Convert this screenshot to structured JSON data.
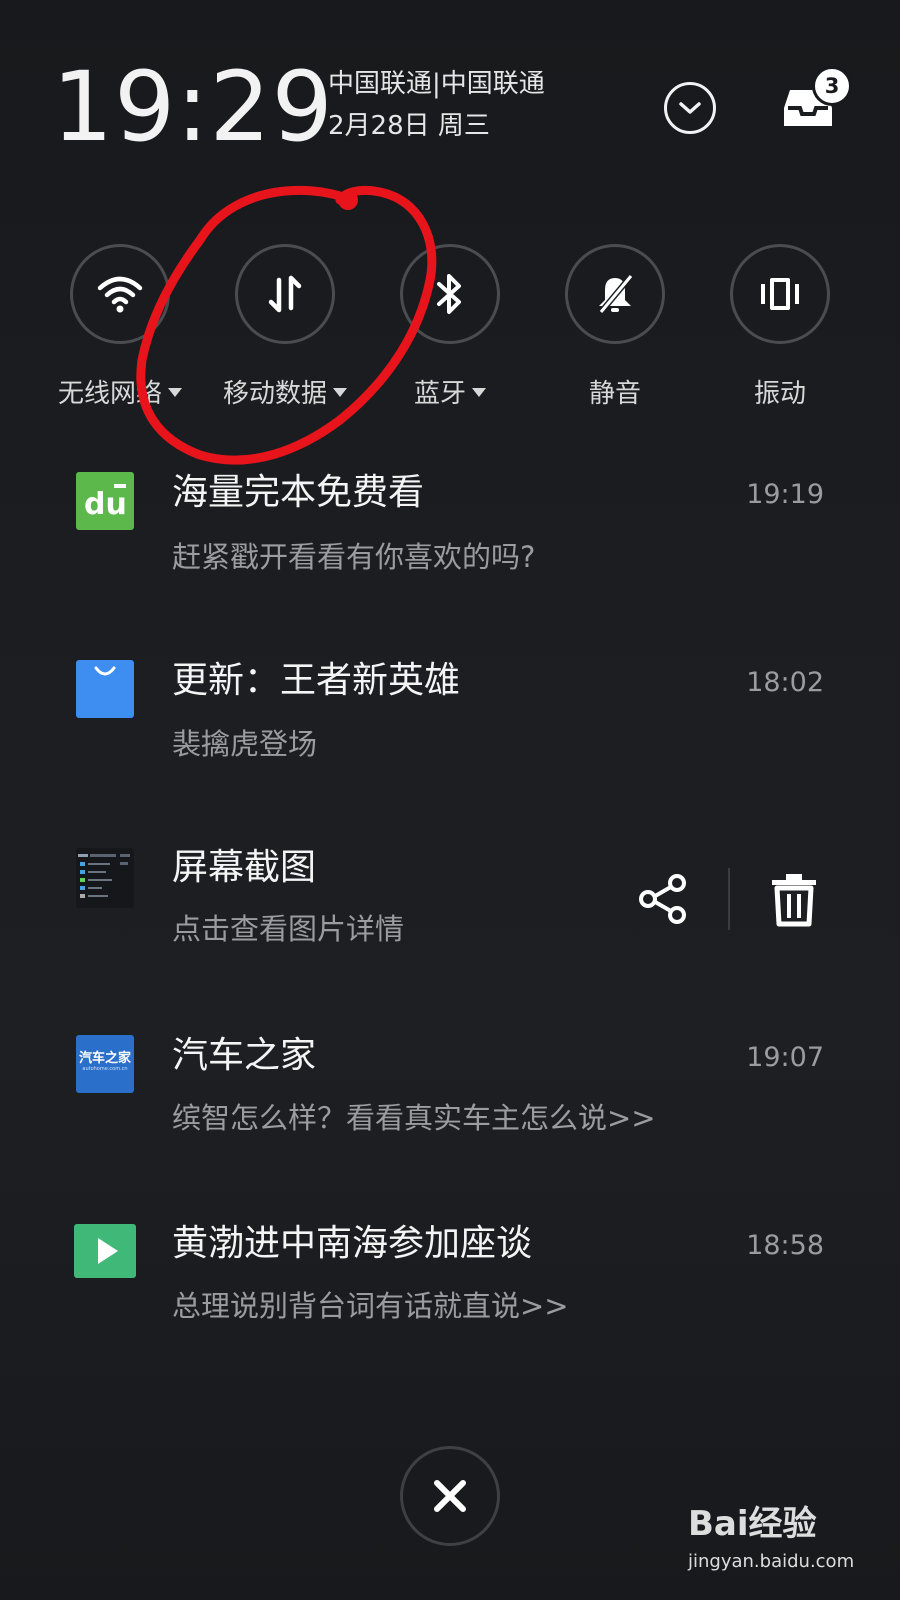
{
  "header": {
    "time": "19:29",
    "carrier": "中国联通|中国联通",
    "date": "2月28日 周三",
    "collapse_icon": "chevron-down-icon",
    "tray_icon": "notification-tray-icon",
    "tray_badge": "3"
  },
  "quick_toggles": [
    {
      "label": "无线网络",
      "icon": "wifi-icon",
      "has_dropdown": true
    },
    {
      "label": "移动数据",
      "icon": "mobile-data-icon",
      "has_dropdown": true
    },
    {
      "label": "蓝牙",
      "icon": "bluetooth-icon",
      "has_dropdown": true
    },
    {
      "label": "静音",
      "icon": "bell-off-icon",
      "has_dropdown": false
    },
    {
      "label": "振动",
      "icon": "vibrate-icon",
      "has_dropdown": false
    }
  ],
  "notifications": [
    {
      "icon": "du-reader-app-icon",
      "title": "海量完本免费看",
      "body": "赶紧戳开看看有你喜欢的吗?",
      "time": "19:19"
    },
    {
      "icon": "app-store-bag-icon",
      "title": "更新：王者新英雄",
      "body": "裴擒虎登场",
      "time": "18:02"
    },
    {
      "icon": "screenshot-thumbnail-icon",
      "title": "屏幕截图",
      "body": "点击查看图片详情",
      "actions": [
        "share-icon",
        "delete-icon"
      ]
    },
    {
      "icon": "autohome-app-icon",
      "icon_text": "汽车之家",
      "icon_subtext": "autohome.com.cn",
      "title": "汽车之家",
      "body": "缤智怎么样？看看真实车主怎么说>>",
      "time": "19:07"
    },
    {
      "icon": "video-play-app-icon",
      "title": "黄渤进中南海参加座谈",
      "body": "总理说别背台词有话就直说>>",
      "time": "18:58"
    }
  ],
  "close_button": {
    "icon": "close-icon"
  },
  "watermark": {
    "logo_text": "Bai经验",
    "url": "jingyan.baidu.com"
  },
  "colors": {
    "background": "#1b1d21",
    "annotation_red": "#e8141c",
    "du_green": "#5cb84a",
    "store_blue": "#3d8ef0",
    "autohome_blue": "#2a6fc9",
    "video_green": "#3fb878"
  }
}
